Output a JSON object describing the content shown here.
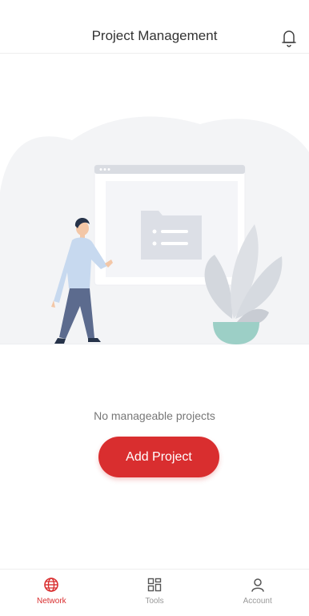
{
  "header": {
    "title": "Project Management",
    "bell_icon": "bell-icon"
  },
  "empty_state": {
    "illustration": "empty-projects-illustration",
    "message": "No manageable projects",
    "add_button_label": "Add Project"
  },
  "tabbar": {
    "tabs": [
      {
        "label": "Network",
        "icon": "globe-icon",
        "active": true
      },
      {
        "label": "Tools",
        "icon": "grid-icon",
        "active": false
      },
      {
        "label": "Account",
        "icon": "person-icon",
        "active": false
      }
    ]
  },
  "colors": {
    "accent": "#d92e2f",
    "inactive": "#999999",
    "text": "#333333"
  }
}
